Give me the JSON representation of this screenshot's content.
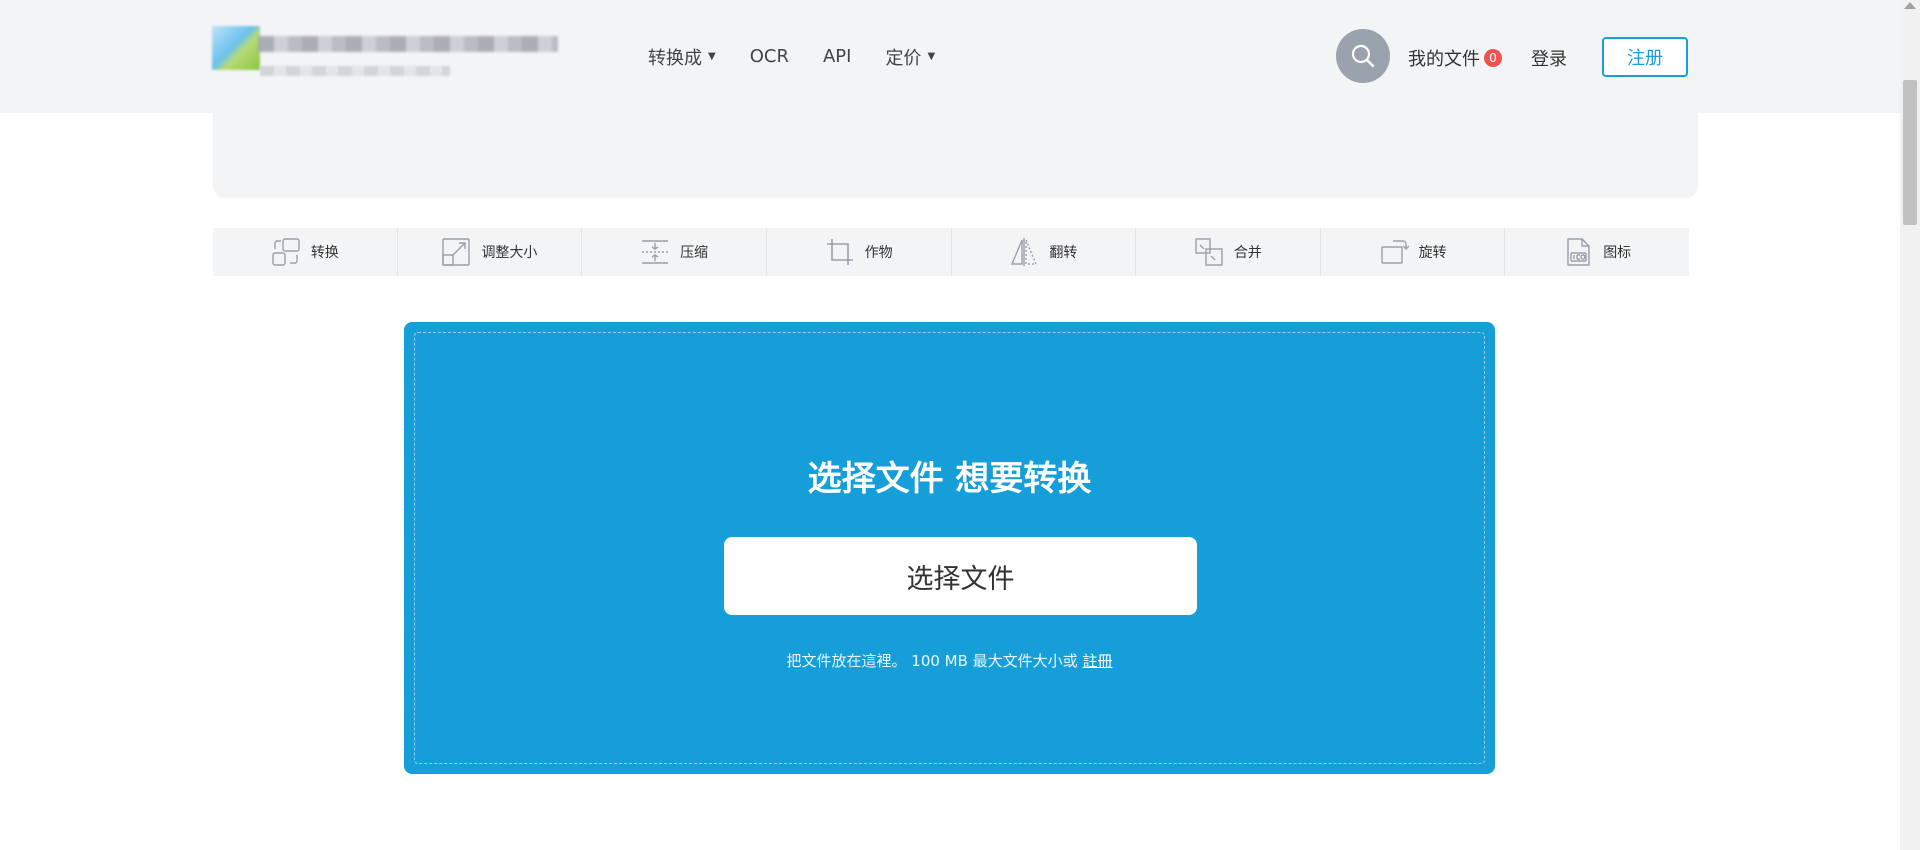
{
  "header": {
    "nav": [
      {
        "label": "转换成",
        "has_dropdown": true
      },
      {
        "label": "OCR",
        "has_dropdown": false
      },
      {
        "label": "API",
        "has_dropdown": false
      },
      {
        "label": "定价",
        "has_dropdown": true
      }
    ],
    "my_files_label": "我的文件",
    "my_files_count": "0",
    "login_label": "登录",
    "register_label": "注册"
  },
  "tools": [
    {
      "label": "转换",
      "icon": "convert-icon"
    },
    {
      "label": "调整大小",
      "icon": "resize-icon"
    },
    {
      "label": "压缩",
      "icon": "compress-icon"
    },
    {
      "label": "作物",
      "icon": "crop-icon"
    },
    {
      "label": "翻转",
      "icon": "flip-icon"
    },
    {
      "label": "合并",
      "icon": "merge-icon"
    },
    {
      "label": "旋转",
      "icon": "rotate-icon"
    },
    {
      "label": "图标",
      "icon": "ico-file-icon"
    }
  ],
  "upload": {
    "title": "选择文件 想要转换",
    "button_label": "选择文件",
    "hint_text": "把文件放在這裡。 100 MB 最大文件大小或 ",
    "hint_link": "註冊"
  },
  "colors": {
    "accent": "#169ed9",
    "header_bg": "#f3f4f6",
    "badge": "#ef5350"
  }
}
